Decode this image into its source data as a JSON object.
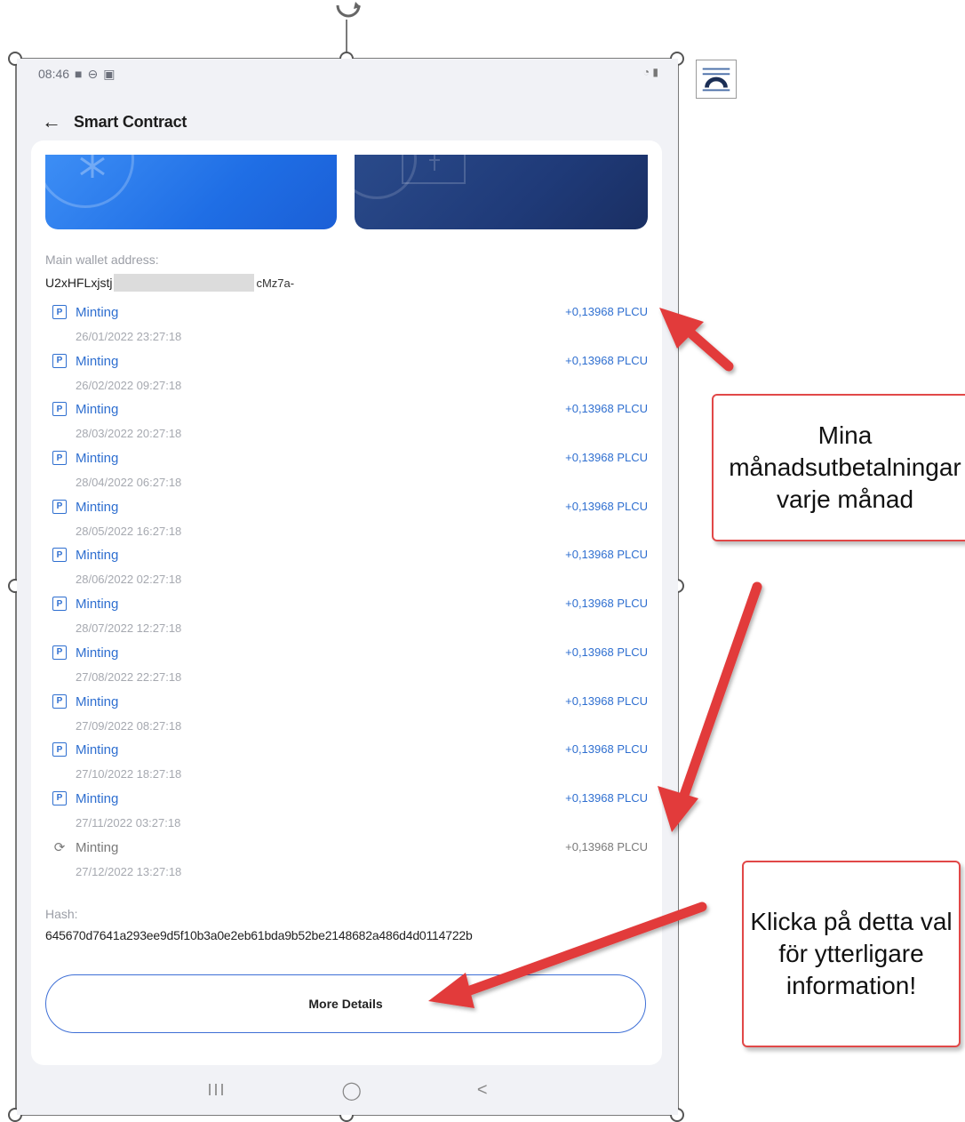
{
  "status_bar": {
    "time": "08:46",
    "icons": [
      "video-icon",
      "dnd-icon",
      "sd-card-icon"
    ],
    "right_icons": [
      "wifi-icon",
      "battery-icon"
    ]
  },
  "header": {
    "back_icon": "arrow-left-icon",
    "title": "Smart Contract"
  },
  "wallet": {
    "label": "Main wallet address:",
    "address_start": "U2xHFLxjstj",
    "address_end": "cMz7a-"
  },
  "transactions": [
    {
      "label": "Minting",
      "date": "26/01/2022 23:27:18",
      "amount": "+0,13968 PLCU",
      "status": "confirmed"
    },
    {
      "label": "Minting",
      "date": "26/02/2022 09:27:18",
      "amount": "+0,13968 PLCU",
      "status": "confirmed"
    },
    {
      "label": "Minting",
      "date": "28/03/2022 20:27:18",
      "amount": "+0,13968 PLCU",
      "status": "confirmed"
    },
    {
      "label": "Minting",
      "date": "28/04/2022 06:27:18",
      "amount": "+0,13968 PLCU",
      "status": "confirmed"
    },
    {
      "label": "Minting",
      "date": "28/05/2022 16:27:18",
      "amount": "+0,13968 PLCU",
      "status": "confirmed"
    },
    {
      "label": "Minting",
      "date": "28/06/2022 02:27:18",
      "amount": "+0,13968 PLCU",
      "status": "confirmed"
    },
    {
      "label": "Minting",
      "date": "28/07/2022 12:27:18",
      "amount": "+0,13968 PLCU",
      "status": "confirmed"
    },
    {
      "label": "Minting",
      "date": "27/08/2022 22:27:18",
      "amount": "+0,13968 PLCU",
      "status": "confirmed"
    },
    {
      "label": "Minting",
      "date": "27/09/2022 08:27:18",
      "amount": "+0,13968 PLCU",
      "status": "confirmed"
    },
    {
      "label": "Minting",
      "date": "27/10/2022 18:27:18",
      "amount": "+0,13968 PLCU",
      "status": "confirmed"
    },
    {
      "label": "Minting",
      "date": "27/11/2022 03:27:18",
      "amount": "+0,13968 PLCU",
      "status": "confirmed"
    },
    {
      "label": "Minting",
      "date": "27/12/2022 13:27:18",
      "amount": "+0,13968 PLCU",
      "status": "pending"
    }
  ],
  "hash": {
    "label": "Hash:",
    "value": "645670d7641a293ee9d5f10b3a0e2eb61bda9b52be2148682a486d4d0114722b"
  },
  "more_details_label": "More Details",
  "nav_bar": {
    "recents": "III",
    "home": "◯",
    "back": "<"
  },
  "callouts": {
    "monthly": "Mina månadsutbetalningar varje månad",
    "click_more": "Klicka på detta val för ytterligare information!"
  },
  "colors": {
    "accent_blue": "#2f6fd0",
    "callout_border": "#e14848",
    "arrow_red": "#e23b3b",
    "banner_1": "#1f6ee5",
    "banner_2": "#1f3a78"
  }
}
